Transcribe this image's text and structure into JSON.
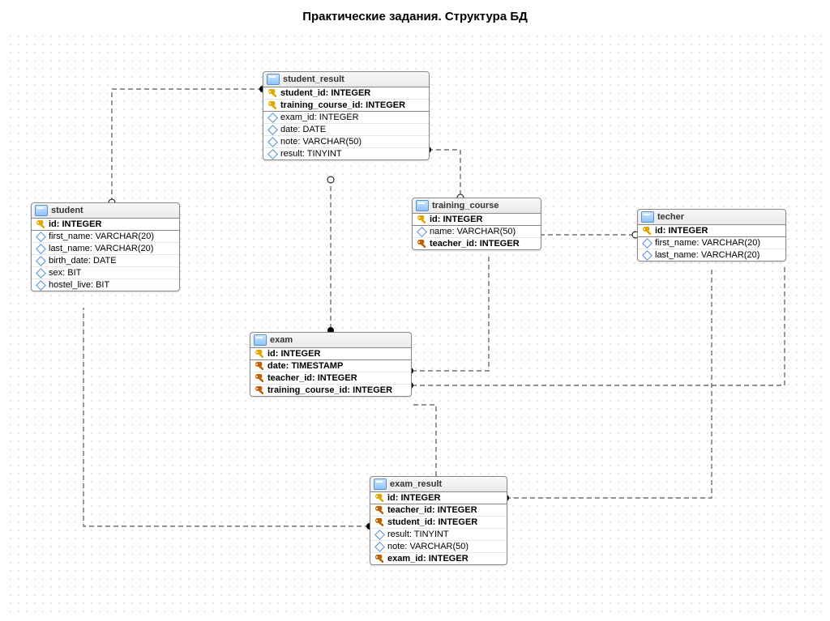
{
  "title": "Практические задания. Структура БД",
  "tables": {
    "student_result": {
      "name": "student_result",
      "cols": [
        {
          "k": "pk",
          "t": "student_id: INTEGER"
        },
        {
          "k": "pk",
          "t": "training_course_id: INTEGER"
        },
        {
          "k": "reg",
          "t": "exam_id: INTEGER"
        },
        {
          "k": "reg",
          "t": "date: DATE"
        },
        {
          "k": "reg",
          "t": "note: VARCHAR(50)"
        },
        {
          "k": "reg",
          "t": "result: TINYINT"
        }
      ]
    },
    "student": {
      "name": "student",
      "cols": [
        {
          "k": "pk",
          "t": "id: INTEGER"
        },
        {
          "k": "reg",
          "t": "first_name: VARCHAR(20)"
        },
        {
          "k": "reg",
          "t": "last_name: VARCHAR(20)"
        },
        {
          "k": "reg",
          "t": "birth_date: DATE"
        },
        {
          "k": "reg",
          "t": "sex: BIT"
        },
        {
          "k": "reg",
          "t": "hostel_live: BIT"
        }
      ]
    },
    "training_course": {
      "name": "training_course",
      "cols": [
        {
          "k": "pk",
          "t": "id: INTEGER"
        },
        {
          "k": "reg",
          "t": "name: VARCHAR(50)"
        },
        {
          "k": "fk",
          "t": "teacher_id: INTEGER"
        }
      ]
    },
    "techer": {
      "name": "techer",
      "cols": [
        {
          "k": "pk",
          "t": "id: INTEGER"
        },
        {
          "k": "reg",
          "t": "first_name: VARCHAR(20)"
        },
        {
          "k": "reg",
          "t": "last_name: VARCHAR(20)"
        }
      ]
    },
    "exam": {
      "name": "exam",
      "cols": [
        {
          "k": "pk",
          "t": "id: INTEGER"
        },
        {
          "k": "fk",
          "t": "date: TIMESTAMP"
        },
        {
          "k": "fk",
          "t": "teacher_id: INTEGER"
        },
        {
          "k": "fk",
          "t": "training_course_id: INTEGER"
        }
      ]
    },
    "exam_result": {
      "name": "exam_result",
      "cols": [
        {
          "k": "pk",
          "t": "id: INTEGER"
        },
        {
          "k": "fk",
          "t": "teacher_id: INTEGER"
        },
        {
          "k": "fk",
          "t": "student_id: INTEGER"
        },
        {
          "k": "reg",
          "t": "result: TINYINT"
        },
        {
          "k": "reg",
          "t": "note: VARCHAR(50)"
        },
        {
          "k": "fk",
          "t": "exam_id: INTEGER"
        }
      ]
    }
  }
}
